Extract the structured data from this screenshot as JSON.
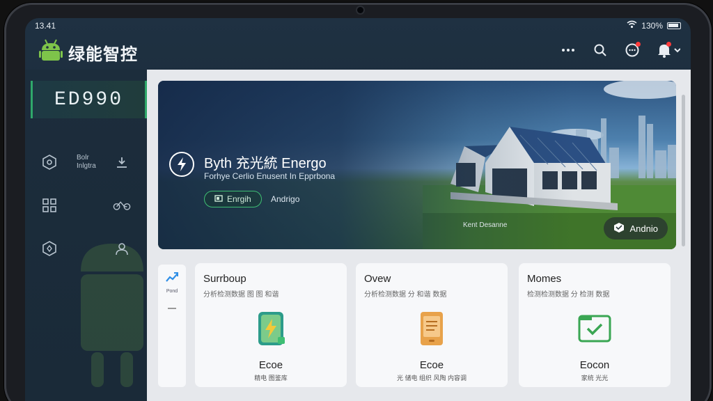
{
  "status_bar": {
    "time": "13.41",
    "battery": "130%"
  },
  "app": {
    "title": "绿能智控"
  },
  "sidebar": {
    "brand": "ED990",
    "rows": [
      {
        "icon": "hexagon-gear-icon",
        "label": "Bolr Inlgtra",
        "secondary_icon": "download-icon"
      },
      {
        "icon": "grid-icon",
        "label": "",
        "secondary_icon": "bike-icon"
      },
      {
        "icon": "hexagon-settings-icon",
        "label": "",
        "secondary_icon": "user-icon"
      }
    ]
  },
  "hero": {
    "title": "Byth 充光統 Energo",
    "subtitle": "Forhye Cerlio Enusent In Epprbona",
    "pill_label": "Enrgih",
    "link_label": "Andrigo",
    "caption": "Kent Desanne",
    "button_label": "Andnio"
  },
  "mini": {
    "label": "Pond"
  },
  "cards": [
    {
      "title": "Surrboup",
      "subtitle": "分析检测数据 图 图 和谐",
      "name": "Ecoe",
      "desc": "精电 图鉴库",
      "icon": "battery-bolt-icon",
      "accent": "#3fbf74"
    },
    {
      "title": "Ovew",
      "subtitle": "分析检测数据 分 和谐 数据",
      "name": "Ecoe",
      "desc": "光 储电 组织 风陶 内容调",
      "icon": "tablet-doc-icon",
      "accent": "#e8a24a"
    },
    {
      "title": "Momes",
      "subtitle": "检测检测数据 分 检测 数据",
      "name": "Eocon",
      "desc": "家统 光光",
      "icon": "checkbox-icon",
      "accent": "#3aa653"
    }
  ],
  "colors": {
    "accent_green": "#3fbf74",
    "notification_red": "#ff3b3b"
  }
}
